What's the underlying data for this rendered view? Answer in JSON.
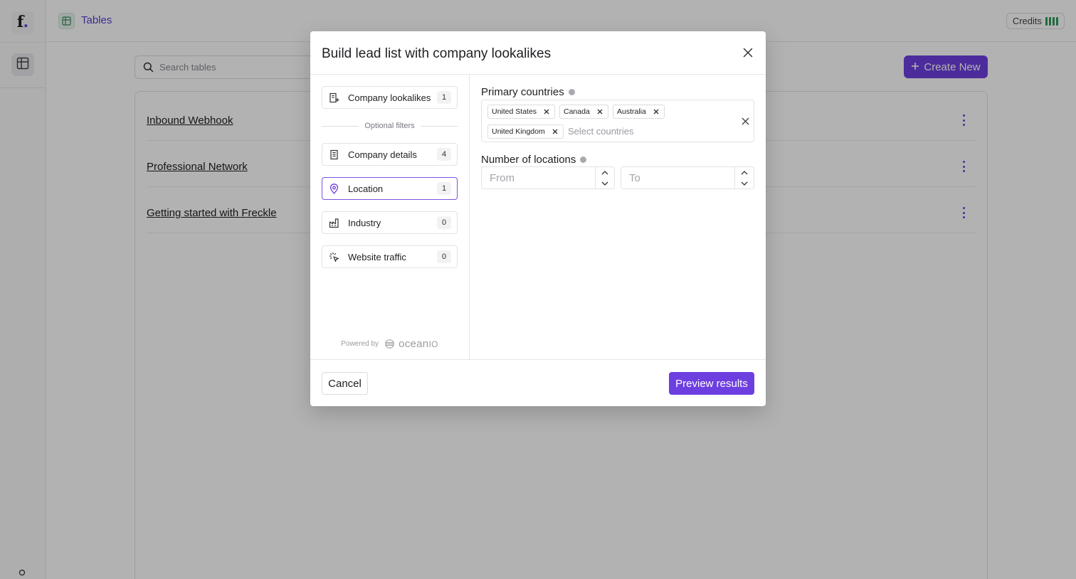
{
  "app": {
    "logo": {
      "letter": "f",
      "dot": "."
    },
    "nav": [
      {
        "icon": "table-icon",
        "active": true
      }
    ],
    "user_icon": "user-icon"
  },
  "topbar": {
    "section_icon": "table-icon",
    "title": "Tables",
    "credits_label": "Credits",
    "credits_bars": 4,
    "credits_color": "#2e9b5a"
  },
  "toolbar": {
    "search_placeholder": "Search tables",
    "create_label": "Create New"
  },
  "tables": [
    {
      "name": "Inbound Webhook"
    },
    {
      "name": "Professional Network"
    },
    {
      "name": "Getting started with Freckle"
    }
  ],
  "modal": {
    "title": "Build lead list with company lookalikes",
    "primary_filter": {
      "label": "Company lookalikes",
      "count": "1",
      "icon": "building-plus-icon"
    },
    "optional_divider": "Optional filters",
    "filters": [
      {
        "label": "Company details",
        "count": "4",
        "icon": "building-icon",
        "active": false
      },
      {
        "label": "Location",
        "count": "1",
        "icon": "map-pin-icon",
        "active": true
      },
      {
        "label": "Industry",
        "count": "0",
        "icon": "factory-icon",
        "active": false
      },
      {
        "label": "Website traffic",
        "count": "0",
        "icon": "sparkle-cursor-icon",
        "active": false
      }
    ],
    "powered_by": "Powered by",
    "brand": "ocean",
    "brand_suffix": "IO",
    "primary_countries": {
      "label": "Primary countries",
      "selected": [
        "United States",
        "Canada",
        "Australia",
        "United Kingdom"
      ],
      "placeholder": "Select countries"
    },
    "number_of_locations": {
      "label": "Number of locations",
      "from_placeholder": "From",
      "to_placeholder": "To",
      "from_value": "",
      "to_value": ""
    },
    "cancel_label": "Cancel",
    "preview_label": "Preview results"
  },
  "colors": {
    "accent": "#6d3fe0",
    "overlay": "rgba(0,0,0,0.30)"
  }
}
